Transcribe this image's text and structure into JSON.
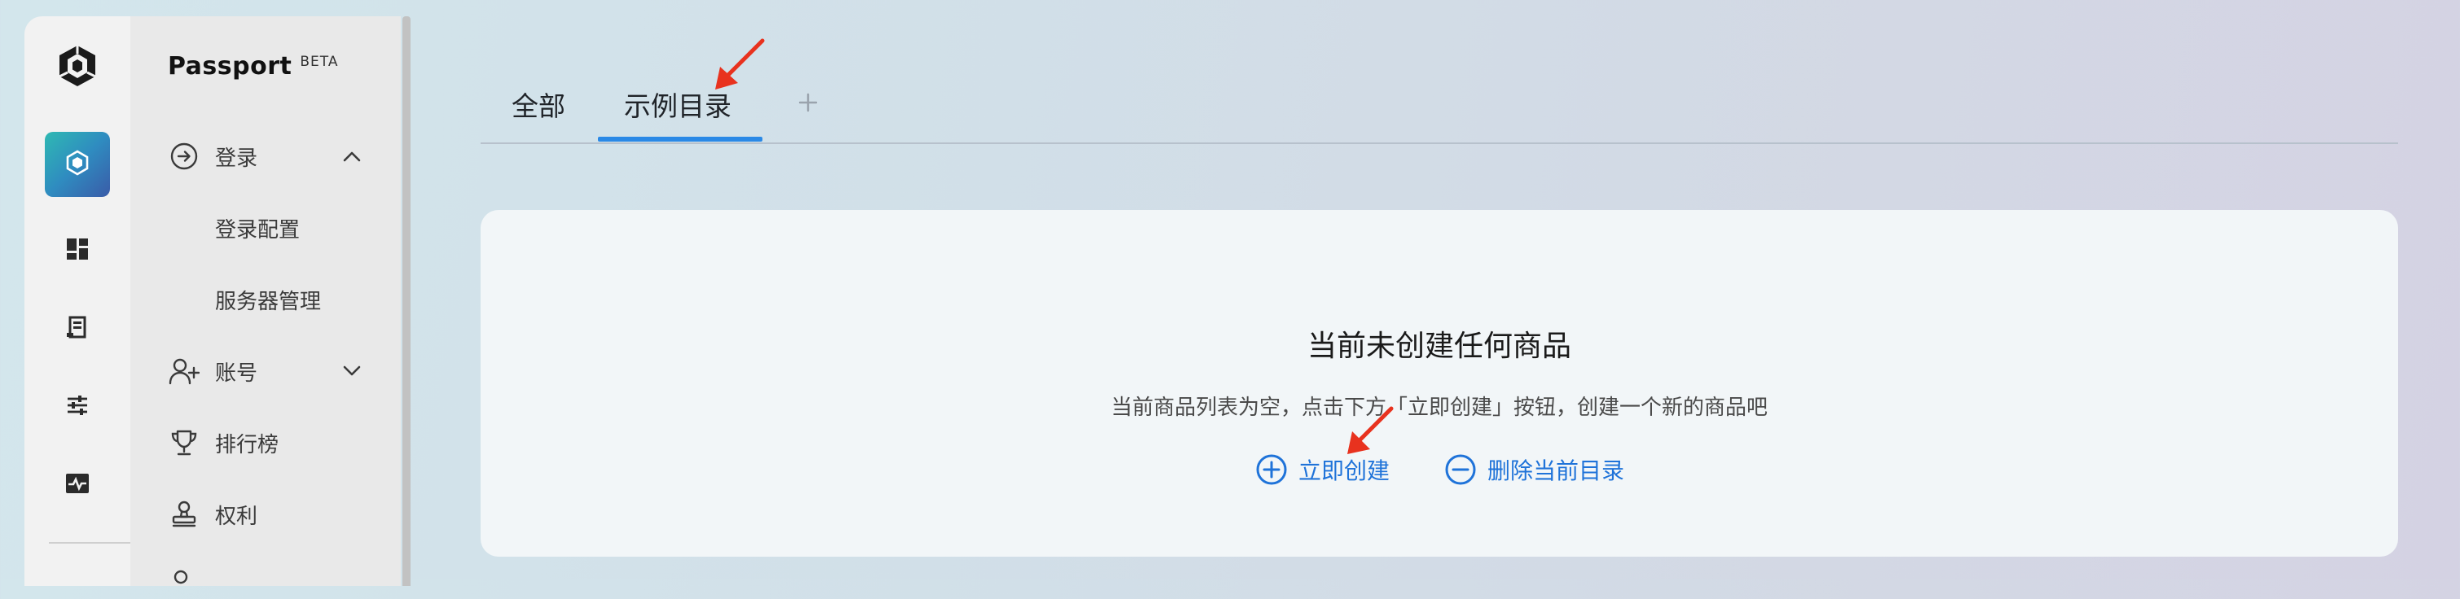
{
  "brand": {
    "name": "Passport",
    "badge": "BETA"
  },
  "rail": {
    "icons": [
      "unity-logo-icon",
      "cube-icon",
      "dashboard-icon",
      "receipt-icon",
      "sliders-icon",
      "activity-icon"
    ],
    "active_gradient": [
      "#2fb9b3",
      "#2f8cc0",
      "#3a5ba8"
    ]
  },
  "sidebar": {
    "items": [
      {
        "label": "登录",
        "icon": "arrow-circle-right-icon",
        "expanded": true
      },
      {
        "label": "登录配置"
      },
      {
        "label": "服务器管理"
      },
      {
        "label": "账号",
        "icon": "add-user-icon",
        "expanded": false
      },
      {
        "label": "排行榜",
        "icon": "trophy-icon"
      },
      {
        "label": "权利",
        "icon": "stamp-icon"
      }
    ]
  },
  "tabs": {
    "items": [
      "全部",
      "示例目录"
    ],
    "active_index": 1,
    "add_symbol": "+",
    "accent": "#2a89e6"
  },
  "empty_state": {
    "title": "当前未创建任何商品",
    "description": "当前商品列表为空，点击下方「立即创建」按钮，创建一个新的商品吧",
    "create_label": "立即创建",
    "delete_label": "删除当前目录",
    "action_color": "#1f73d9"
  },
  "annotation_color": "#e8321e"
}
